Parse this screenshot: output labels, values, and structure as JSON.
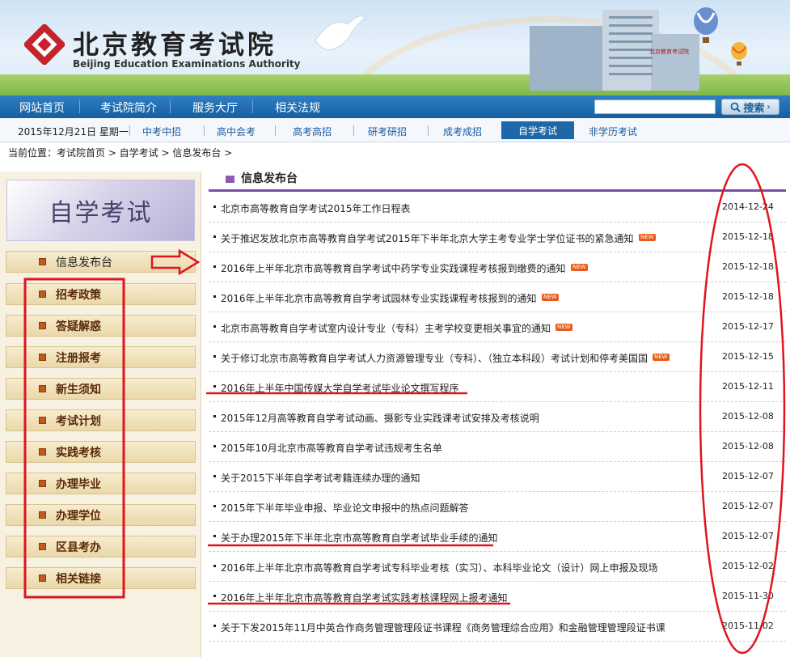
{
  "header": {
    "logo_cn": "北京教育考试院",
    "logo_en": "Beijing Education Examinations Authority",
    "building_sign": "北京教育考试院"
  },
  "nav": {
    "items": [
      "网站首页",
      "考试院简介",
      "服务大厅",
      "相关法规"
    ],
    "search_label": "搜索"
  },
  "subnav": {
    "date": "2015年12月21日  星期一",
    "links": [
      "中考中招",
      "高中会考",
      "高考高招",
      "研考研招",
      "成考成招",
      "自学考试",
      "非学历考试"
    ],
    "active": "自学考试"
  },
  "breadcrumb": "当前位置：考试院首页 > 自学考试 > 信息发布台 >",
  "sidebar": {
    "header": "自学考试",
    "items": [
      "信息发布台",
      "招考政策",
      "答疑解惑",
      "注册报考",
      "新生须知",
      "考试计划",
      "实践考核",
      "办理毕业",
      "办理学位",
      "区县考办",
      "相关链接"
    ]
  },
  "main": {
    "title": "信息发布台",
    "news": [
      {
        "title": "北京市高等教育自学考试2015年工作日程表",
        "date": "2014-12-24",
        "new": false
      },
      {
        "title": "关于推迟发放北京市高等教育自学考试2015年下半年北京大学主考专业学士学位证书的紧急通知",
        "date": "2015-12-18",
        "new": true
      },
      {
        "title": "2016年上半年北京市高等教育自学考试中药学专业实践课程考核报到缴费的通知",
        "date": "2015-12-18",
        "new": true
      },
      {
        "title": "2016年上半年北京市高等教育自学考试园林专业实践课程考核报到的通知",
        "date": "2015-12-18",
        "new": true
      },
      {
        "title": "北京市高等教育自学考试室内设计专业（专科）主考学校变更相关事宜的通知",
        "date": "2015-12-17",
        "new": true
      },
      {
        "title": "关于修订北京市高等教育自学考试人力资源管理专业（专科）、（独立本科段）考试计划和停考美国国",
        "date": "2015-12-15",
        "new": true
      },
      {
        "title": "2016年上半年中国传媒大学自学考试毕业论文撰写程序",
        "date": "2015-12-11",
        "new": false
      },
      {
        "title": "2015年12月高等教育自学考试动画、摄影专业实践课考试安排及考核说明",
        "date": "2015-12-08",
        "new": false
      },
      {
        "title": "2015年10月北京市高等教育自学考试违规考生名单",
        "date": "2015-12-08",
        "new": false
      },
      {
        "title": "关于2015下半年自学考试考籍连续办理的通知",
        "date": "2015-12-07",
        "new": false
      },
      {
        "title": "2015年下半年毕业申报、毕业论文申报中的热点问题解答",
        "date": "2015-12-07",
        "new": false
      },
      {
        "title": "关于办理2015年下半年北京市高等教育自学考试毕业手续的通知",
        "date": "2015-12-07",
        "new": false
      },
      {
        "title": "2016年上半年北京市高等教育自学考试专科毕业考核（实习）、本科毕业论文（设计）网上申报及现场",
        "date": "2015-12-02",
        "new": false
      },
      {
        "title": "2016年上半年北京市高等教育自学考试实践考核课程网上报考通知",
        "date": "2015-11-30",
        "new": false
      },
      {
        "title": "关于下发2015年11月中英合作商务管理管理段证书课程《商务管理综合应用》和金融管理管理段证书课",
        "date": "2015-11-02",
        "new": false
      }
    ],
    "new_badge": "NEW"
  },
  "colors": {
    "nav_blue": "#1e67a9",
    "accent_purple": "#7a4ea8",
    "annotation_red": "#e0141e"
  }
}
